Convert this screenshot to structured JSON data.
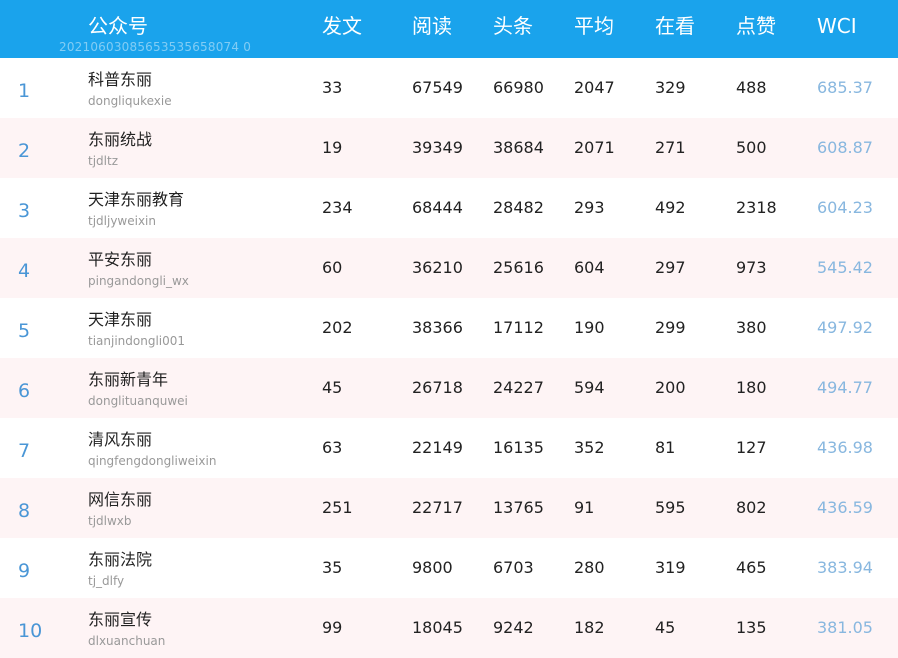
{
  "header": {
    "columns": [
      "公众号",
      "发文",
      "阅读",
      "头条",
      "平均",
      "在看",
      "点赞",
      "WCI"
    ],
    "watermark": "20210603085653535658074 0"
  },
  "rows": [
    {
      "rank": "1",
      "name": "科普东丽",
      "account": "dongliqukexie",
      "posts": "33",
      "reads": "67549",
      "top": "66980",
      "avg": "2047",
      "watching": "329",
      "likes": "488",
      "wci": "685.37"
    },
    {
      "rank": "2",
      "name": "东丽统战",
      "account": "tjdltz",
      "posts": "19",
      "reads": "39349",
      "top": "38684",
      "avg": "2071",
      "watching": "271",
      "likes": "500",
      "wci": "608.87"
    },
    {
      "rank": "3",
      "name": "天津东丽教育",
      "account": "tjdljyweixin",
      "posts": "234",
      "reads": "68444",
      "top": "28482",
      "avg": "293",
      "watching": "492",
      "likes": "2318",
      "wci": "604.23"
    },
    {
      "rank": "4",
      "name": "平安东丽",
      "account": "pingandongli_wx",
      "posts": "60",
      "reads": "36210",
      "top": "25616",
      "avg": "604",
      "watching": "297",
      "likes": "973",
      "wci": "545.42"
    },
    {
      "rank": "5",
      "name": "天津东丽",
      "account": "tianjindongli001",
      "posts": "202",
      "reads": "38366",
      "top": "17112",
      "avg": "190",
      "watching": "299",
      "likes": "380",
      "wci": "497.92"
    },
    {
      "rank": "6",
      "name": "东丽新青年",
      "account": "donglituanquwei",
      "posts": "45",
      "reads": "26718",
      "top": "24227",
      "avg": "594",
      "watching": "200",
      "likes": "180",
      "wci": "494.77"
    },
    {
      "rank": "7",
      "name": "清风东丽",
      "account": "qingfengdongliweixin",
      "posts": "63",
      "reads": "22149",
      "top": "16135",
      "avg": "352",
      "watching": "81",
      "likes": "127",
      "wci": "436.98"
    },
    {
      "rank": "8",
      "name": "网信东丽",
      "account": "tjdlwxb",
      "posts": "251",
      "reads": "22717",
      "top": "13765",
      "avg": "91",
      "watching": "595",
      "likes": "802",
      "wci": "436.59"
    },
    {
      "rank": "9",
      "name": "东丽法院",
      "account": "tj_dlfy",
      "posts": "35",
      "reads": "9800",
      "top": "6703",
      "avg": "280",
      "watching": "319",
      "likes": "465",
      "wci": "383.94"
    },
    {
      "rank": "10",
      "name": "东丽宣传",
      "account": "dlxuanchuan",
      "posts": "99",
      "reads": "18045",
      "top": "9242",
      "avg": "182",
      "watching": "45",
      "likes": "135",
      "wci": "381.05"
    }
  ],
  "colors": {
    "header_bg": "#1aa3ec",
    "rank": "#4a96d6",
    "wci": "#88b7df",
    "alt_row": "#fef4f5"
  }
}
